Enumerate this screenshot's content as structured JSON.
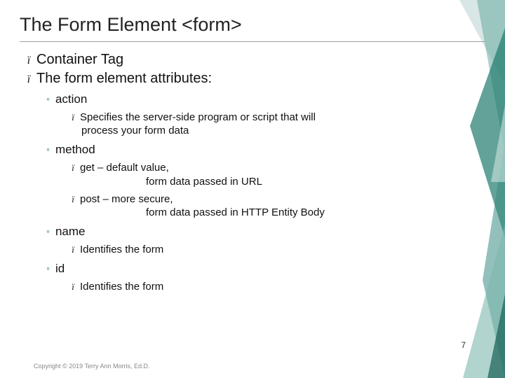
{
  "title": "The Form Element <form>",
  "bullets": {
    "container": "Container Tag",
    "attrs": "The form element attributes:"
  },
  "attributes": {
    "action": {
      "label": "action",
      "desc1": "Specifies the server-side program or script that will",
      "desc2": "process your form data"
    },
    "method": {
      "label": "method",
      "get1": "get – default value,",
      "get2": "form data passed in URL",
      "post1": "post – more secure,",
      "post2": "form data passed in HTTP Entity Body"
    },
    "name": {
      "label": "name",
      "desc": "Identifies the form"
    },
    "id": {
      "label": "id",
      "desc": "Identifies the form"
    }
  },
  "page_number": "7",
  "copyright": "Copyright © 2019 Terry Ann Morris, Ed.D."
}
